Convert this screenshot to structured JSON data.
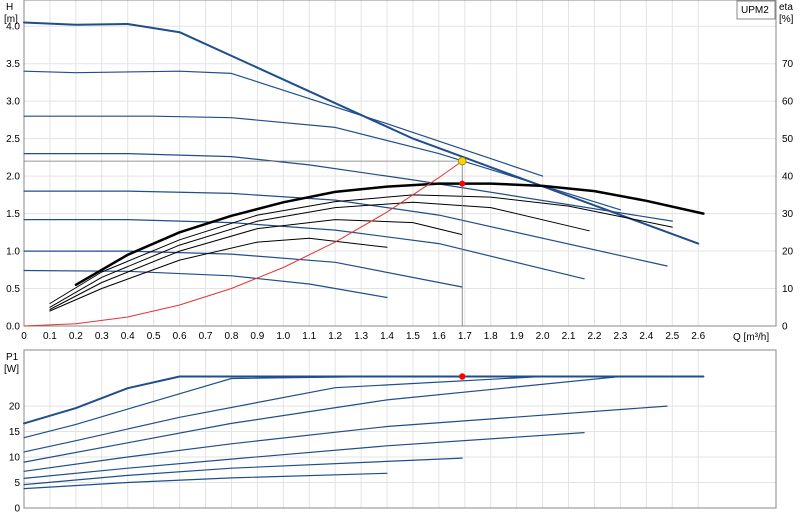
{
  "chart_data": [
    {
      "type": "line",
      "model_label": "UPM2",
      "ylabel_left": "H",
      "ylabel_left_unit": "[m]",
      "ylabel_right": "eta",
      "ylabel_right_unit": "[%]",
      "xlabel": "Q [m³/h]",
      "xlim": [
        0,
        2.9
      ],
      "ylim": [
        0,
        4.35
      ],
      "ylim_right": [
        0,
        87
      ],
      "x_ticks": [
        "0",
        "0.1",
        "0.2",
        "0.3",
        "0.4",
        "0.5",
        "0.6",
        "0.7",
        "0.8",
        "0.9",
        "1.0",
        "1.1",
        "1.2",
        "1.3",
        "1.4",
        "1.5",
        "1.6",
        "1.7",
        "1.8",
        "1.9",
        "2.0",
        "2.1",
        "2.2",
        "2.3",
        "2.4",
        "2.5",
        "2.6"
      ],
      "y_ticks": [
        "0.0",
        "0.5",
        "1.0",
        "1.5",
        "2.0",
        "2.5",
        "3.0",
        "3.5",
        "4.0"
      ],
      "y_right_ticks": [
        "0",
        "10",
        "20",
        "30",
        "40",
        "50",
        "60",
        "70"
      ],
      "grid": true,
      "series": [
        {
          "role": "max-head",
          "color": "#1f4e8c",
          "width": 2,
          "x": [
            0,
            0.2,
            0.4,
            0.6,
            1.5,
            2.6
          ],
          "y": [
            4.05,
            4.02,
            4.03,
            3.92,
            2.5,
            1.1
          ]
        },
        {
          "role": "head",
          "color": "#1f4e8c",
          "width": 1.2,
          "x": [
            0,
            0.2,
            0.6,
            0.8,
            1.4,
            2.0
          ],
          "y": [
            3.4,
            3.38,
            3.4,
            3.37,
            2.7,
            2.0
          ]
        },
        {
          "role": "head",
          "color": "#1f4e8c",
          "width": 1.2,
          "x": [
            0,
            0.5,
            0.8,
            1.2,
            1.6,
            2.3
          ],
          "y": [
            2.8,
            2.8,
            2.78,
            2.65,
            2.3,
            1.55
          ]
        },
        {
          "role": "head",
          "color": "#1f4e8c",
          "width": 1.2,
          "x": [
            0,
            0.4,
            0.8,
            1.1,
            1.5,
            2.5
          ],
          "y": [
            2.3,
            2.3,
            2.26,
            2.15,
            1.95,
            1.4
          ]
        },
        {
          "role": "head",
          "color": "#1f4e8c",
          "width": 1.2,
          "x": [
            0,
            0.4,
            0.8,
            1.2,
            1.6,
            2.48
          ],
          "y": [
            1.8,
            1.8,
            1.77,
            1.68,
            1.48,
            0.8
          ]
        },
        {
          "role": "head",
          "color": "#1f4e8c",
          "width": 1.2,
          "x": [
            0,
            0.4,
            0.8,
            1.2,
            1.6,
            2.16
          ],
          "y": [
            1.42,
            1.42,
            1.38,
            1.28,
            1.1,
            0.63
          ]
        },
        {
          "role": "head",
          "color": "#1f4e8c",
          "width": 1.2,
          "x": [
            0,
            0.4,
            0.8,
            1.2,
            1.69
          ],
          "y": [
            1.0,
            1.0,
            0.96,
            0.85,
            0.52
          ]
        },
        {
          "role": "head",
          "color": "#1f4e8c",
          "width": 1.2,
          "x": [
            0,
            0.4,
            0.8,
            1.1,
            1.4
          ],
          "y": [
            0.74,
            0.73,
            0.67,
            0.56,
            0.38
          ]
        },
        {
          "role": "max-efficiency",
          "color": "#000000",
          "width": 2.5,
          "x": [
            0.2,
            0.4,
            0.6,
            0.8,
            1.0,
            1.2,
            1.4,
            1.6,
            1.8,
            2.0,
            2.2,
            2.4,
            2.62
          ],
          "y": [
            0.55,
            0.95,
            1.25,
            1.47,
            1.65,
            1.79,
            1.86,
            1.9,
            1.9,
            1.87,
            1.8,
            1.67,
            1.5
          ]
        },
        {
          "role": "efficiency",
          "color": "#000000",
          "width": 1,
          "x": [
            0.1,
            0.3,
            0.6,
            0.9,
            1.2,
            1.5,
            1.8,
            2.1,
            2.5
          ],
          "y": [
            0.3,
            0.72,
            1.15,
            1.48,
            1.66,
            1.75,
            1.72,
            1.6,
            1.32
          ]
        },
        {
          "role": "efficiency",
          "color": "#000000",
          "width": 1,
          "x": [
            0.1,
            0.3,
            0.6,
            0.9,
            1.2,
            1.5,
            1.8,
            2.18
          ],
          "y": [
            0.25,
            0.65,
            1.08,
            1.4,
            1.58,
            1.65,
            1.58,
            1.27
          ]
        },
        {
          "role": "efficiency",
          "color": "#000000",
          "width": 1,
          "x": [
            0.1,
            0.3,
            0.6,
            0.9,
            1.2,
            1.5,
            1.69
          ],
          "y": [
            0.22,
            0.58,
            1.0,
            1.3,
            1.42,
            1.38,
            1.22
          ]
        },
        {
          "role": "efficiency",
          "color": "#000000",
          "width": 1,
          "x": [
            0.1,
            0.3,
            0.6,
            0.9,
            1.1,
            1.4
          ],
          "y": [
            0.2,
            0.5,
            0.88,
            1.12,
            1.17,
            1.05
          ]
        },
        {
          "role": "system-curve",
          "color": "#e63232",
          "width": 1,
          "x": [
            0,
            0.2,
            0.4,
            0.6,
            0.8,
            1.0,
            1.2,
            1.4,
            1.6,
            1.69
          ],
          "y": [
            0,
            0.03,
            0.12,
            0.28,
            0.5,
            0.78,
            1.12,
            1.52,
            1.98,
            2.2
          ]
        }
      ],
      "duty_point": {
        "x": 1.69,
        "y": 2.2,
        "color": "#ffd400"
      },
      "efficiency_point": {
        "x": 1.69,
        "y": 1.9,
        "color": "#ff0000"
      }
    },
    {
      "type": "line",
      "ylabel": "P1",
      "ylabel_unit": "[W]",
      "xlim": [
        0,
        2.9
      ],
      "ylim": [
        0,
        31
      ],
      "y_ticks": [
        "0",
        "5",
        "10",
        "15",
        "20"
      ],
      "grid": true,
      "series": [
        {
          "role": "max-power",
          "color": "#1f4e8c",
          "width": 2,
          "x": [
            0,
            0.2,
            0.4,
            0.6,
            2.62
          ],
          "y": [
            16.6,
            19.6,
            23.5,
            25.8,
            25.8
          ]
        },
        {
          "role": "power",
          "color": "#1f4e8c",
          "width": 1.2,
          "x": [
            0,
            0.2,
            0.4,
            0.8,
            1.4
          ],
          "y": [
            13.8,
            16.4,
            19.4,
            25.4,
            25.8
          ]
        },
        {
          "role": "power",
          "color": "#1f4e8c",
          "width": 1.2,
          "x": [
            0,
            0.2,
            0.6,
            1.2,
            2.0
          ],
          "y": [
            11.0,
            13.2,
            17.8,
            23.6,
            25.8
          ]
        },
        {
          "role": "power",
          "color": "#1f4e8c",
          "width": 1.2,
          "x": [
            0,
            0.4,
            0.8,
            1.4,
            2.3
          ],
          "y": [
            9.0,
            12.8,
            16.6,
            21.2,
            25.8
          ]
        },
        {
          "role": "power",
          "color": "#1f4e8c",
          "width": 1.2,
          "x": [
            0,
            0.4,
            0.8,
            1.4,
            2.48
          ],
          "y": [
            7.2,
            10.0,
            12.6,
            16.0,
            20.0
          ]
        },
        {
          "role": "power",
          "color": "#1f4e8c",
          "width": 1.2,
          "x": [
            0,
            0.4,
            0.8,
            1.4,
            2.16
          ],
          "y": [
            5.8,
            7.8,
            9.6,
            12.2,
            14.8
          ]
        },
        {
          "role": "power",
          "color": "#1f4e8c",
          "width": 1.2,
          "x": [
            0,
            0.4,
            0.8,
            1.69
          ],
          "y": [
            4.6,
            6.4,
            7.8,
            9.8
          ]
        },
        {
          "role": "power",
          "color": "#1f4e8c",
          "width": 1.2,
          "x": [
            0,
            0.4,
            0.8,
            1.4
          ],
          "y": [
            3.8,
            5.0,
            5.9,
            6.8
          ]
        }
      ],
      "operating_point": {
        "x": 1.69,
        "y": 25.8,
        "color": "#ff0000"
      }
    }
  ]
}
